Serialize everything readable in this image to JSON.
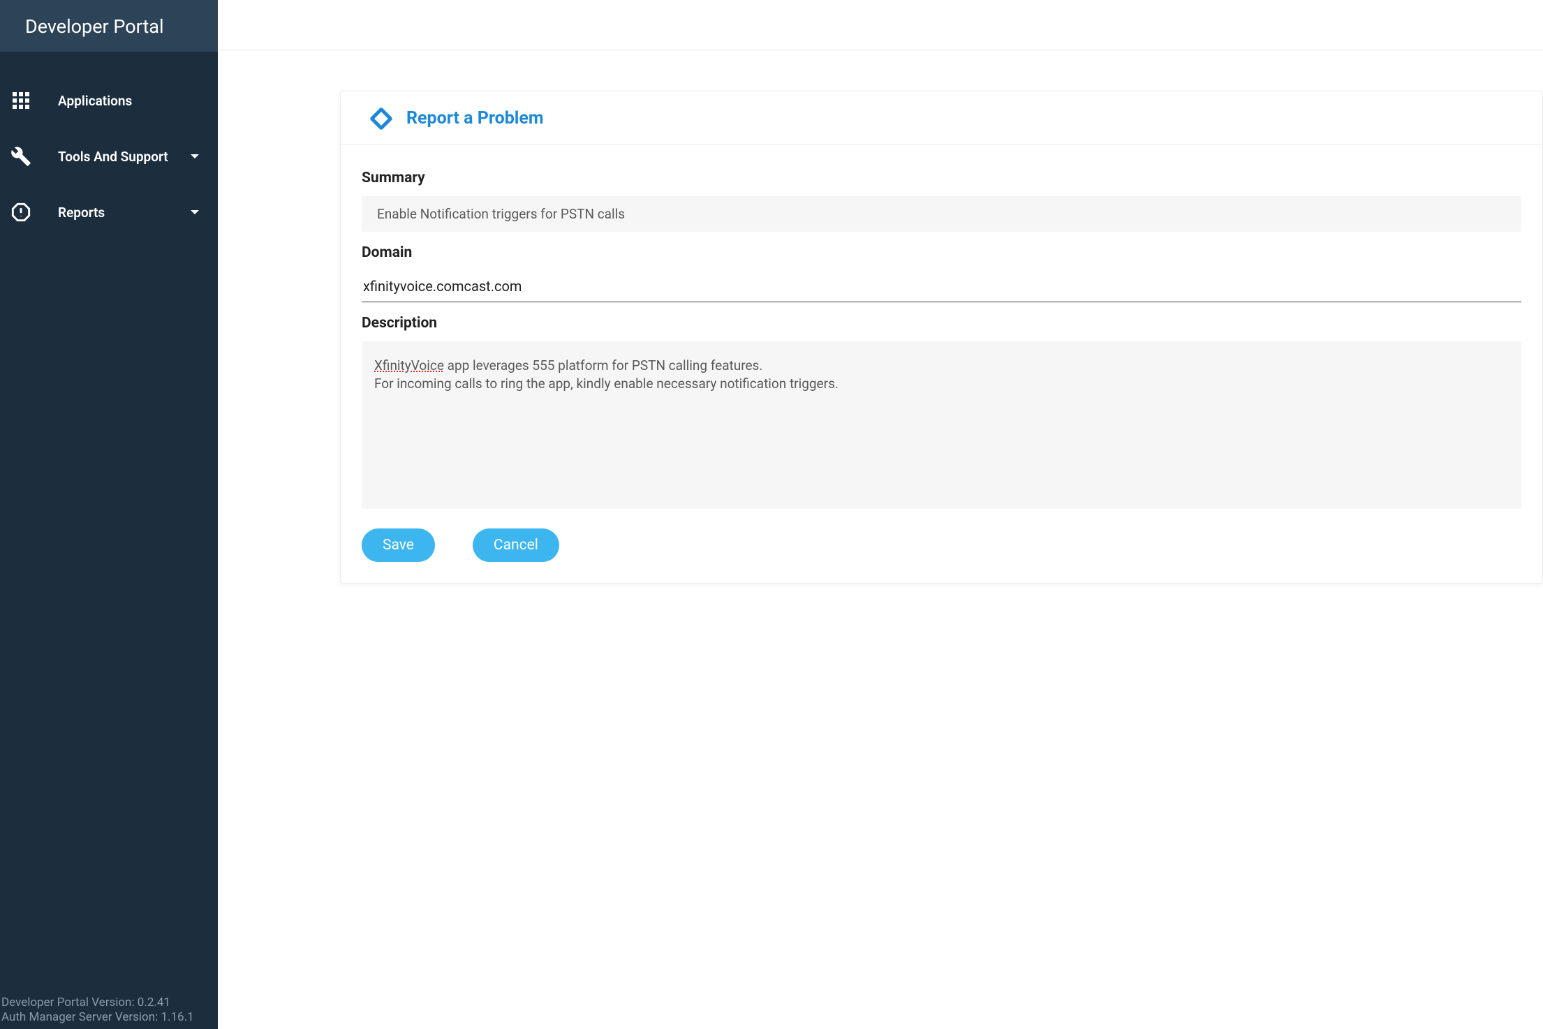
{
  "sidebar": {
    "title": "Developer Portal",
    "items": [
      {
        "label": "Applications",
        "icon": "grid-icon",
        "hasDropdown": false
      },
      {
        "label": "Tools And Support",
        "icon": "wrench-icon",
        "hasDropdown": true
      },
      {
        "label": "Reports",
        "icon": "alert-icon",
        "hasDropdown": true
      }
    ],
    "footer": {
      "version_line_1": "Developer Portal Version: 0.2.41",
      "version_line_2": "Auth Manager Server Version: 1.16.1"
    }
  },
  "card": {
    "title": "Report a Problem",
    "form": {
      "summary": {
        "label": "Summary",
        "value": "Enable Notification triggers for PSTN calls"
      },
      "domain": {
        "label": "Domain",
        "value": "xfinityvoice.comcast.com"
      },
      "description": {
        "label": "Description",
        "value": "XfinityVoice app leverages 555 platform for PSTN calling features.\nFor incoming calls to ring the app, kindly enable necessary notification triggers.",
        "spellcheck_word": "XfinityVoice",
        "rest_line1": " app leverages 555 platform for PSTN calling features.",
        "line2": "For incoming calls to ring the app, kindly enable necessary notification triggers."
      }
    },
    "buttons": {
      "save": "Save",
      "cancel": "Cancel"
    }
  }
}
